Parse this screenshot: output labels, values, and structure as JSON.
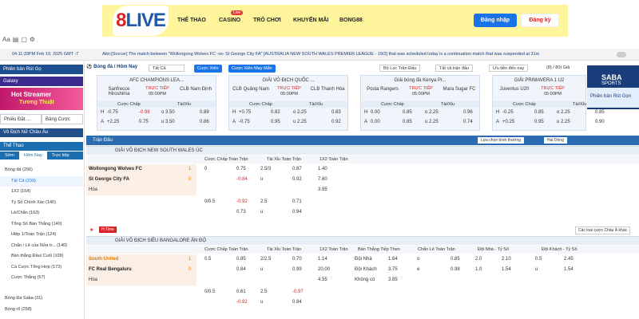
{
  "header": {
    "logo_a": "8",
    "logo_b": "LIVE",
    "menu": [
      "THỂ THAO",
      "CASINO",
      "TRÒ CHƠI",
      "KHUYẾN MÃI",
      "BONG88"
    ],
    "live_badge": "Live",
    "login": "Đăng nhập",
    "register": "Đăng ký"
  },
  "ticker": {
    "time": "04:11:33PM Feb 19, 2025 GMT -7",
    "message": "Attn:[Soccer] The match between \"Wollongong Wolves FC -vs- St George City FA\" [AUSTRALIA NEW SOUTH WALES PREMIER LEAGUE - 19/2] that was scheduled today is a continuation match that was suspended at 31st"
  },
  "sidebar": {
    "promo1": "Phiên bản Rút Gọ",
    "promo2": "Galaxy",
    "banner_title": "Hot Streamer",
    "banner_sub": "Tương Thuật",
    "tabs": [
      "Phiếu Đặt ...",
      "Bảng Cược"
    ],
    "fav": "Vô Địch Nữ Châu Âu",
    "sport": "Thể Thao",
    "subtabs": [
      "Sớm",
      "Hôm Nay",
      "Trực tiếp"
    ],
    "items": [
      {
        "label": "Bóng đá",
        "count": "(296)"
      },
      {
        "label": "Tất Cả",
        "count": "(239)"
      },
      {
        "label": "1X2",
        "count": "(164)"
      },
      {
        "label": "Tỷ Số Chính Xác",
        "count": "(140)"
      },
      {
        "label": "Lẻ/Chẵn",
        "count": "(163)"
      },
      {
        "label": "Tổng Số Bàn Thắng",
        "count": "(140)"
      },
      {
        "label": "Hiệp 1/Toàn Trận",
        "count": "(124)"
      },
      {
        "label": "Chẵn / Lẻ của Nửa tr...",
        "count": "(140)"
      },
      {
        "label": "Bàn thắng Đầu/ Cuối",
        "count": "(109)"
      },
      {
        "label": "Cá Cược Tổng Hợp",
        "count": "(173)"
      },
      {
        "label": "Cược Thắng",
        "count": "(57)"
      },
      {
        "label": "Bóng Đá Saba",
        "count": "(31)"
      },
      {
        "label": "Bóng rổ",
        "count": "(258)"
      }
    ]
  },
  "tabs": {
    "sport": "Bóng đá / Hôm Nay",
    "all": "Tất Cả",
    "cuoc_xien": "Cược Xiên",
    "cuoc_xien_may_man": "Cược Xiên May Mắn",
    "filter_league": "Bộ Lọc Trận Đấu",
    "filter_all": "Tất cả trận đấu",
    "filter_prio": "Ưu tiên đến nay",
    "filter_count": "(8) / 80) Giả"
  },
  "cards": [
    {
      "league": "AFC CHAMPIONS LEA...",
      "home": "Sanfrecce Hiroshima",
      "away": "CLB Nam Định",
      "live": "TRỰC TIẾP",
      "time": "05:00PM",
      "h_hdp": "-0.75",
      "h_hdp_odds": "-0.98",
      "h_ou": "o 3.50",
      "h_ou_odds": "0.89",
      "a_hdp": "+2.25",
      "a_hdp_odds": "0.75",
      "a_ou": "u 3.50",
      "a_ou_odds": "0.86"
    },
    {
      "league": "GIẢI VÔ ĐỊCH QUỐC ...",
      "home": "CLB Quảng Nam",
      "away": "CLB Thanh Hóa",
      "live": "TRỰC TIẾP",
      "time": "05:00PM",
      "h_hdp": "+0.75",
      "h_hdp_odds": "0.82",
      "h_ou": "o 2.25",
      "h_ou_odds": "0.83",
      "a_hdp": "-0.75",
      "a_hdp_odds": "0.95",
      "a_ou": "u 2.25",
      "a_ou_odds": "0.92"
    },
    {
      "league": "Giải bóng đá Kenya Pr...",
      "home": "Posta Rangers",
      "away": "Mara Sugar FC",
      "live": "TRỰC TIẾP",
      "time": "05:00PM",
      "h_hdp": "0.00",
      "h_hdp_odds": "0.85",
      "h_ou": "o 2.25",
      "h_ou_odds": "0.96",
      "a_hdp": "0.00",
      "a_hdp_odds": "0.85",
      "a_ou": "u 2.25",
      "a_ou_odds": "0.74"
    },
    {
      "league": "GIẢI PRIMAVERA 1 U2",
      "home": "Juventus U20",
      "away": "",
      "live": "TRỰC TIẾP",
      "time": "05:00PM",
      "h_hdp": "-0.25",
      "h_hdp_odds": "0.85",
      "h_ou": "o 2.25",
      "h_ou_odds": "0.85",
      "a_hdp": "+0.25",
      "a_hdp_odds": "0.95",
      "a_ou": "u 2.25",
      "a_ou_odds": "0.90"
    }
  ],
  "card_hdr": {
    "hdp": "Cược Chấp",
    "ou": "Tài/Xỉu"
  },
  "main": {
    "title": "Trận Đấu",
    "sort": "Lựa chọn bình thường",
    "view": "Hai Dòng",
    "league1": "GIẢI VÔ ĐỊCH NEW SOUTH WALES ÚC",
    "league2": "GIẢI VÔ ĐỊCH SIÊU BANGALORE ẤN ĐỘ",
    "col_hdp": "Cược Chấp Toàn Trận",
    "col_ou": "Tài Xỉu Toàn Trận",
    "col_1x2": "1X2 Toàn Trận",
    "col_goals": "Bàn Thắng Tiếp Theo",
    "col_oe": "Chẵn Lẻ Toàn Trận",
    "col_home": "Đội Nhà - Tỷ Số",
    "col_away": "Đội Khách - Tỷ Số",
    "bet_type": "Các loại cược Châu Á khác",
    "m1": {
      "home": "Wollongong Wolves FC",
      "away": "St George City FA",
      "draw": "Hòa",
      "hs": "1",
      "as": "0",
      "r1": [
        "0",
        "0.75",
        "2.5/3",
        "0.87",
        "1.40"
      ],
      "r2": [
        "",
        "-0.84",
        "u",
        "0.92",
        "7.60"
      ],
      "r3": [
        "",
        "",
        "",
        "",
        "3.95"
      ],
      "r4": [
        "0/0.5",
        "-0.92",
        "2.5",
        "0.71"
      ],
      "r5": [
        "",
        "0.73",
        "u",
        "0.94"
      ]
    },
    "m2": {
      "home": "South United",
      "away": "FC Real Bengaluru",
      "draw": "Hòa",
      "hs": "1",
      "as": "0",
      "r1": [
        "0.5",
        "0.85",
        "2/2.5",
        "0.70",
        "1.14",
        "Đội Nhà",
        "1.64",
        "o",
        "0.85",
        "2.0",
        "2.10",
        "0.5",
        "2.45"
      ],
      "r2": [
        "",
        "0.84",
        "u",
        "0.99",
        "20.00",
        "Đội Khách",
        "3.75",
        "e",
        "0.98",
        "1.0",
        "1.54",
        "u",
        "1.54"
      ],
      "r3": [
        "",
        "",
        "",
        "",
        "4.55",
        "Không có",
        "3.85"
      ],
      "r4": [
        "0/0.5",
        "0.61",
        "2.5",
        "-0.97"
      ],
      "r5": [
        "",
        "-0.92",
        "u",
        "0.84"
      ]
    },
    "hlive": "H.Time"
  },
  "right_banner": {
    "brand": "SABA",
    "sub": "SPORTS",
    "tag": "Phiên bản Rút Gọn"
  }
}
